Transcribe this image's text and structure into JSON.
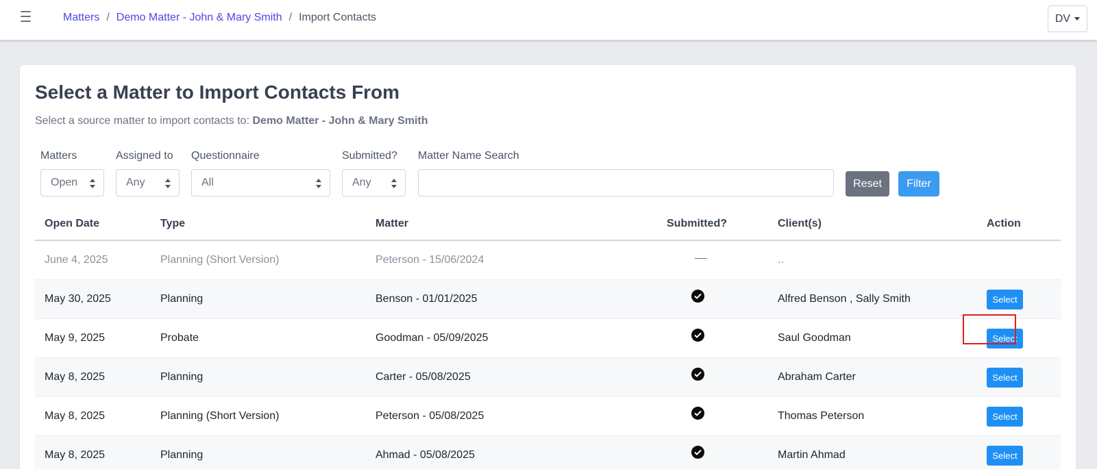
{
  "topbar": {
    "menu_icon": "hamburger-icon",
    "breadcrumb": [
      {
        "label": "Matters"
      },
      {
        "label": "Demo Matter - John & Mary Smith"
      },
      {
        "label": "Import Contacts"
      }
    ],
    "separator": "/",
    "user_initials": "DV"
  },
  "page": {
    "title": "Select a Matter to Import Contacts From",
    "subtitle_prefix": "Select a source matter to import contacts to:",
    "subtitle_target": "Demo Matter - John & Mary Smith"
  },
  "filters": {
    "matters": {
      "label": "Matters",
      "value": "Open"
    },
    "assigned": {
      "label": "Assigned to",
      "value": "Any"
    },
    "questionnaire": {
      "label": "Questionnaire",
      "value": "All"
    },
    "submitted": {
      "label": "Submitted?",
      "value": "Any"
    },
    "search": {
      "label": "Matter Name Search",
      "value": ""
    },
    "reset_label": "Reset",
    "filter_label": "Filter"
  },
  "table": {
    "headers": {
      "open_date": "Open Date",
      "type": "Type",
      "matter": "Matter",
      "submitted": "Submitted?",
      "clients": "Client(s)",
      "action": "Action"
    },
    "rows": [
      {
        "open_date": "June 4, 2025",
        "type": "Planning (Short Version)",
        "matter": "Peterson - 15/06/2024",
        "submitted": "__",
        "clients": "..",
        "action": ""
      },
      {
        "open_date": "May 30, 2025",
        "type": "Planning",
        "matter": "Benson - 01/01/2025",
        "submitted": "check",
        "clients": "Alfred Benson , Sally Smith",
        "action": "Select"
      },
      {
        "open_date": "May 9, 2025",
        "type": "Probate",
        "matter": "Goodman - 05/09/2025",
        "submitted": "check",
        "clients": "Saul Goodman",
        "action": "Select"
      },
      {
        "open_date": "May 8, 2025",
        "type": "Planning",
        "matter": "Carter - 05/08/2025",
        "submitted": "check",
        "clients": "Abraham Carter",
        "action": "Select"
      },
      {
        "open_date": "May 8, 2025",
        "type": "Planning (Short Version)",
        "matter": "Peterson - 05/08/2025",
        "submitted": "check",
        "clients": "Thomas Peterson",
        "action": "Select"
      },
      {
        "open_date": "May 8, 2025",
        "type": "Planning",
        "matter": "Ahmad - 05/08/2025",
        "submitted": "check",
        "clients": "Martin Ahmad",
        "action": "Select"
      }
    ]
  },
  "colors": {
    "link": "#4f46e5",
    "primary_button": "#1e90f5",
    "filter_button": "#3b9bf0",
    "reset_button": "#6b7280",
    "highlight": "#e11d1d"
  }
}
